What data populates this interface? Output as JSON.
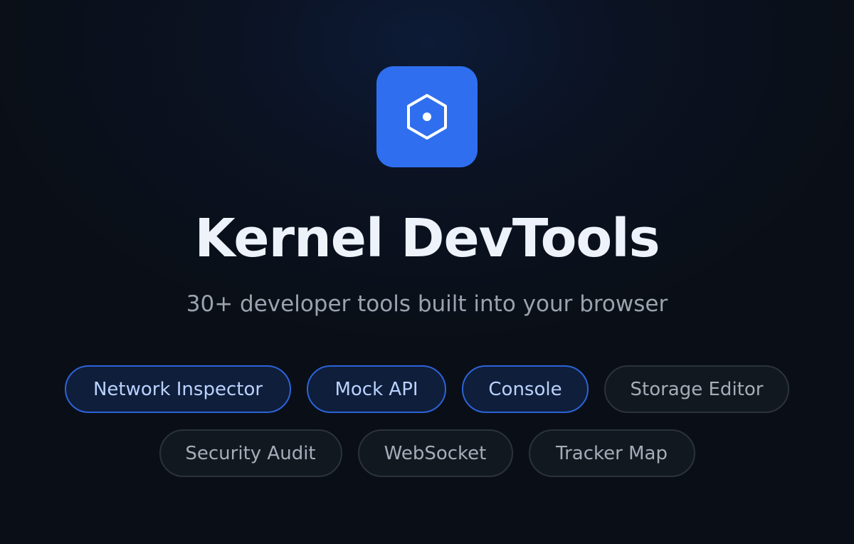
{
  "app": {
    "logo_icon": "hexagon-dot-icon",
    "title": "Kernel DevTools",
    "subtitle": "30+ developer tools built into your browser"
  },
  "colors": {
    "accent": "#2f6fef",
    "background": "#0a0f17",
    "chip_active_border": "#2c63d9",
    "chip_inactive_border": "#2b323b"
  },
  "features": {
    "row1": [
      {
        "label": "Network Inspector",
        "active": true
      },
      {
        "label": "Mock API",
        "active": true
      },
      {
        "label": "Console",
        "active": true
      },
      {
        "label": "Storage Editor",
        "active": false
      }
    ],
    "row2": [
      {
        "label": "Security Audit",
        "active": false
      },
      {
        "label": "WebSocket",
        "active": false
      },
      {
        "label": "Tracker Map",
        "active": false
      }
    ]
  }
}
